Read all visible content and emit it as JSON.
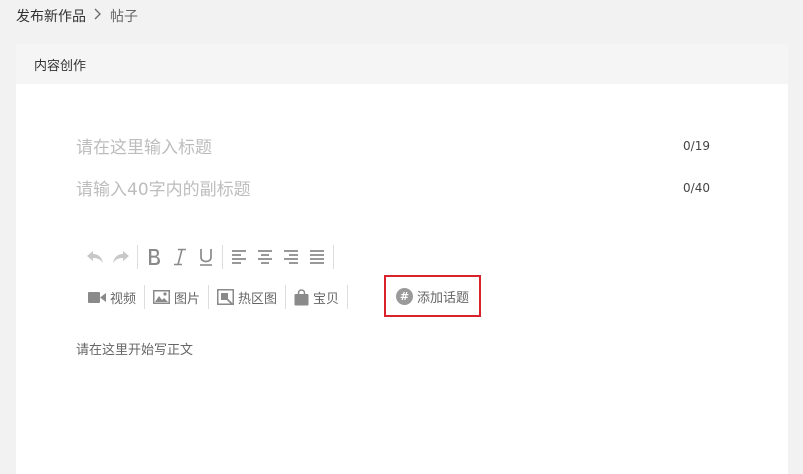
{
  "breadcrumb": {
    "parent": "发布新作品",
    "current": "帖子"
  },
  "panel": {
    "title": "内容创作"
  },
  "editor": {
    "title_placeholder": "请在这里输入标题",
    "title_count": "0/19",
    "subtitle_placeholder": "请输入40字内的副标题",
    "subtitle_count": "0/40",
    "body_placeholder": "请在这里开始写正文"
  },
  "toolbar": {
    "format_icons": [
      "undo-icon",
      "redo-icon",
      "bold-icon",
      "italic-icon",
      "underline-icon",
      "align-left-icon",
      "align-center-icon",
      "align-right-icon",
      "align-justify-icon"
    ],
    "insert": {
      "video": "视频",
      "image": "图片",
      "hotspot": "热区图",
      "product": "宝贝",
      "topic": "添加话题"
    }
  },
  "colors": {
    "highlight_border": "#d9222a",
    "placeholder": "#bdbdbd"
  }
}
